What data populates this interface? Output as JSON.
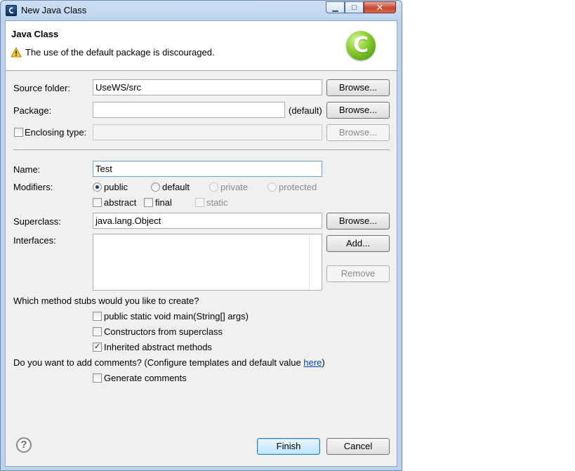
{
  "window": {
    "title": "New Java Class",
    "colors": {
      "accent": "#bcd3ee",
      "dialog_bg": "#f0f0f0",
      "close": "#c8452f",
      "logo_green": "#86cc2a",
      "link": "#0645ad"
    }
  },
  "header": {
    "title": "Java Class",
    "message": "The use of the default package is discouraged.",
    "message_icon": "warning-icon",
    "logo_icon": "class-c-icon"
  },
  "form": {
    "source_folder": {
      "label": "Source folder:",
      "value": "UseWS/src",
      "button": "Browse..."
    },
    "package": {
      "label": "Package:",
      "value": "",
      "hint": "(default)",
      "button": "Browse..."
    },
    "enclosing_type": {
      "label": "Enclosing type:",
      "checked": false,
      "value": "",
      "button": "Browse..."
    },
    "name": {
      "label": "Name:",
      "value": "Test"
    },
    "modifiers": {
      "label": "Modifiers:",
      "access": [
        {
          "label": "public",
          "selected": true,
          "enabled": true
        },
        {
          "label": "default",
          "selected": false,
          "enabled": true
        },
        {
          "label": "private",
          "selected": false,
          "enabled": false
        },
        {
          "label": "protected",
          "selected": false,
          "enabled": false
        }
      ],
      "flags": [
        {
          "label": "abstract",
          "checked": false,
          "enabled": true
        },
        {
          "label": "final",
          "checked": false,
          "enabled": true
        },
        {
          "label": "static",
          "checked": false,
          "enabled": false
        }
      ]
    },
    "superclass": {
      "label": "Superclass:",
      "value": "java.lang.Object",
      "button": "Browse..."
    },
    "interfaces": {
      "label": "Interfaces:",
      "add_button": "Add...",
      "remove_button": "Remove"
    },
    "stubs": {
      "question": "Which method stubs would you like to create?",
      "options": [
        {
          "label": "public static void main(String[] args)",
          "checked": false
        },
        {
          "label": "Constructors from superclass",
          "checked": false
        },
        {
          "label": "Inherited abstract methods",
          "checked": true
        }
      ]
    },
    "comments": {
      "question_prefix": "Do you want to add comments? (Configure templates and default value ",
      "link": "here",
      "question_suffix": ")",
      "option": {
        "label": "Generate comments",
        "checked": false
      }
    }
  },
  "footer": {
    "help_icon": "help-icon",
    "finish_button": "Finish",
    "cancel_button": "Cancel"
  }
}
